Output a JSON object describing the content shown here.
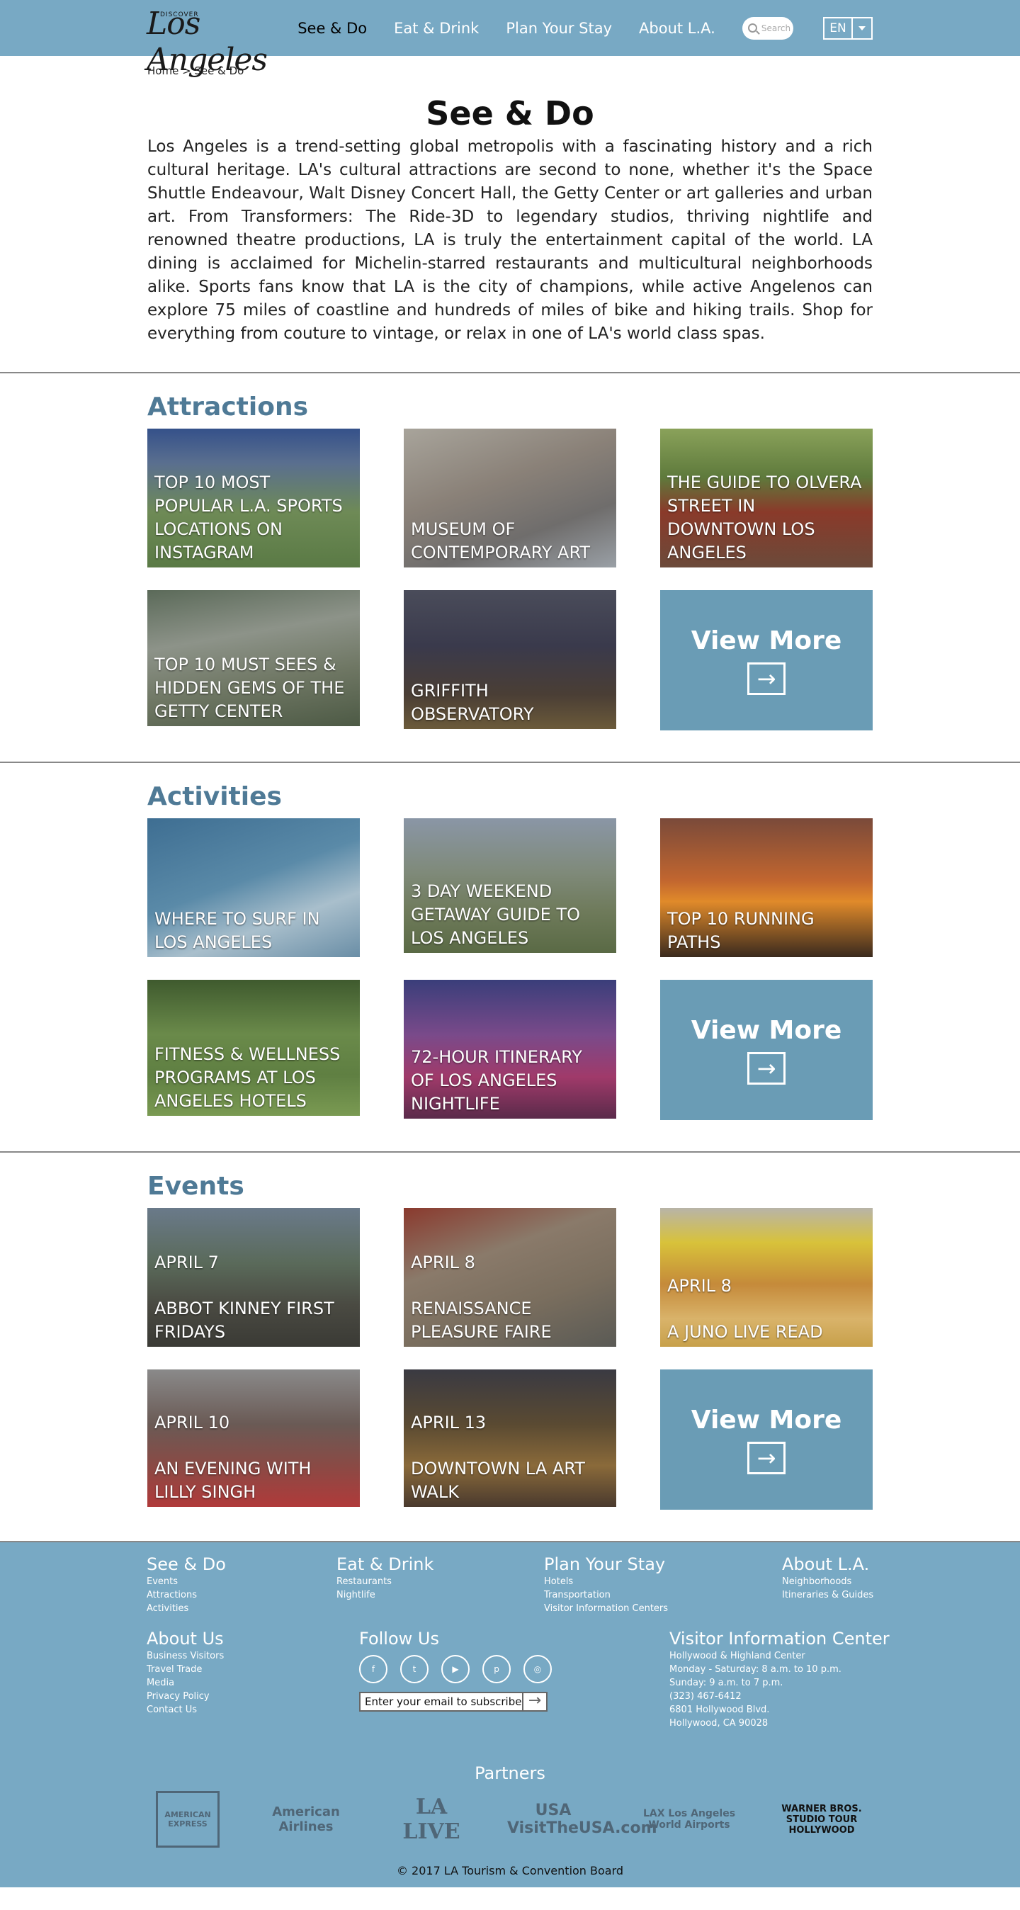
{
  "header": {
    "logo_small": "DISCOVER",
    "logo_script": "Los Angeles",
    "nav": [
      {
        "label": "See & Do",
        "active": true
      },
      {
        "label": "Eat & Drink",
        "active": false
      },
      {
        "label": "Plan Your Stay",
        "active": false
      },
      {
        "label": "About L.A.",
        "active": false
      }
    ],
    "search_placeholder": "Search",
    "language": "EN"
  },
  "breadcrumb": "Home > See & Do",
  "intro": {
    "title": "See & Do",
    "body": "Los Angeles is a trend-setting global metropolis with a fascinating history and a rich cultural heritage. LA's cultural attractions are second to none, whether it's the Space Shuttle Endeavour, Walt Disney Concert Hall, the Getty Center or art galleries and urban art. From Transformers: The Ride-3D to legendary studios, thriving nightlife and renowned theatre productions, LA is truly the entertainment capital of the world. LA dining is acclaimed for Michelin-starred restaurants and multicultural neighborhoods alike. Sports fans know that LA is the city of champions, while active Angelenos can explore 75 miles of coastline and hundreds of miles of bike and hiking trails. Shop for everything from couture to vintage, or relax in one of LA's world class spas."
  },
  "sections": {
    "attractions": {
      "heading": "Attractions",
      "cards": [
        {
          "title": "TOP 10 MOST POPULAR L.A. SPORTS LOCATIONS ON INSTAGRAM"
        },
        {
          "title": "MUSEUM OF CONTEMPORARY ART"
        },
        {
          "title": "THE GUIDE TO OLVERA STREET IN DOWNTOWN LOS ANGELES"
        },
        {
          "title": "TOP 10 MUST SEES & HIDDEN GEMS OF THE GETTY CENTER"
        },
        {
          "title": "GRIFFITH OBSERVATORY"
        }
      ]
    },
    "activities": {
      "heading": "Activities",
      "cards": [
        {
          "title": "WHERE TO SURF IN LOS ANGELES"
        },
        {
          "title": "3 DAY WEEKEND GETAWAY GUIDE TO LOS ANGELES"
        },
        {
          "title": "TOP 10 RUNNING PATHS"
        },
        {
          "title": "FITNESS & WELLNESS PROGRAMS AT LOS ANGELES HOTELS"
        },
        {
          "title": "72-HOUR ITINERARY OF LOS ANGELES NIGHTLIFE"
        }
      ]
    },
    "events": {
      "heading": "Events",
      "cards": [
        {
          "date": "APRIL 7",
          "title": "ABBOT KINNEY FIRST FRIDAYS"
        },
        {
          "date": "APRIL 8",
          "title": "RENAISSANCE PLEASURE FAIRE"
        },
        {
          "date": "APRIL 8",
          "title": "A JUNO LIVE READ"
        },
        {
          "date": "APRIL 10",
          "title": "AN EVENING WITH LILLY SINGH"
        },
        {
          "date": "APRIL 13",
          "title": "DOWNTOWN LA ART WALK"
        }
      ]
    },
    "view_more_label": "View More"
  },
  "footer": {
    "columns": [
      {
        "heading": "See & Do",
        "links": [
          "Events",
          "Attractions",
          "Activities"
        ]
      },
      {
        "heading": "Eat & Drink",
        "links": [
          "Restaurants",
          "Nightlife"
        ]
      },
      {
        "heading": "Plan Your Stay",
        "links": [
          "Hotels",
          "Transportation",
          "Visitor Information Centers"
        ]
      },
      {
        "heading": "About L.A.",
        "links": [
          "Neighborhoods",
          "Itineraries & Guides"
        ]
      }
    ],
    "about_us": {
      "heading": "About Us",
      "links": [
        "Business Visitors",
        "Travel Trade",
        "Media",
        "Privacy Policy",
        "Contact Us"
      ]
    },
    "follow_us": {
      "heading": "Follow Us",
      "socials": [
        "f",
        "t",
        "▶",
        "p",
        "◎"
      ],
      "subscribe_placeholder": "Enter your email to subscribe"
    },
    "visitor_center": {
      "heading": "Visitor Information Center",
      "lines": [
        "Hollywood & Highland Center",
        "Monday - Saturday: 8 a.m. to 10 p.m.",
        "Sunday: 9 a.m. to 7 p.m.",
        "(323) 467-6412",
        "6801 Hollywood Blvd.",
        "Hollywood, CA 90028"
      ]
    },
    "partners_heading": "Partners",
    "partners": [
      "AMERICAN EXPRESS",
      "American Airlines",
      "LA LIVE",
      "USA VisitTheUSA.com",
      "LAX Los Angeles World Airports",
      "WARNER BROS. STUDIO TOUR HOLLYWOOD"
    ],
    "copyright": "© 2017 LA Tourism & Convention Board"
  }
}
